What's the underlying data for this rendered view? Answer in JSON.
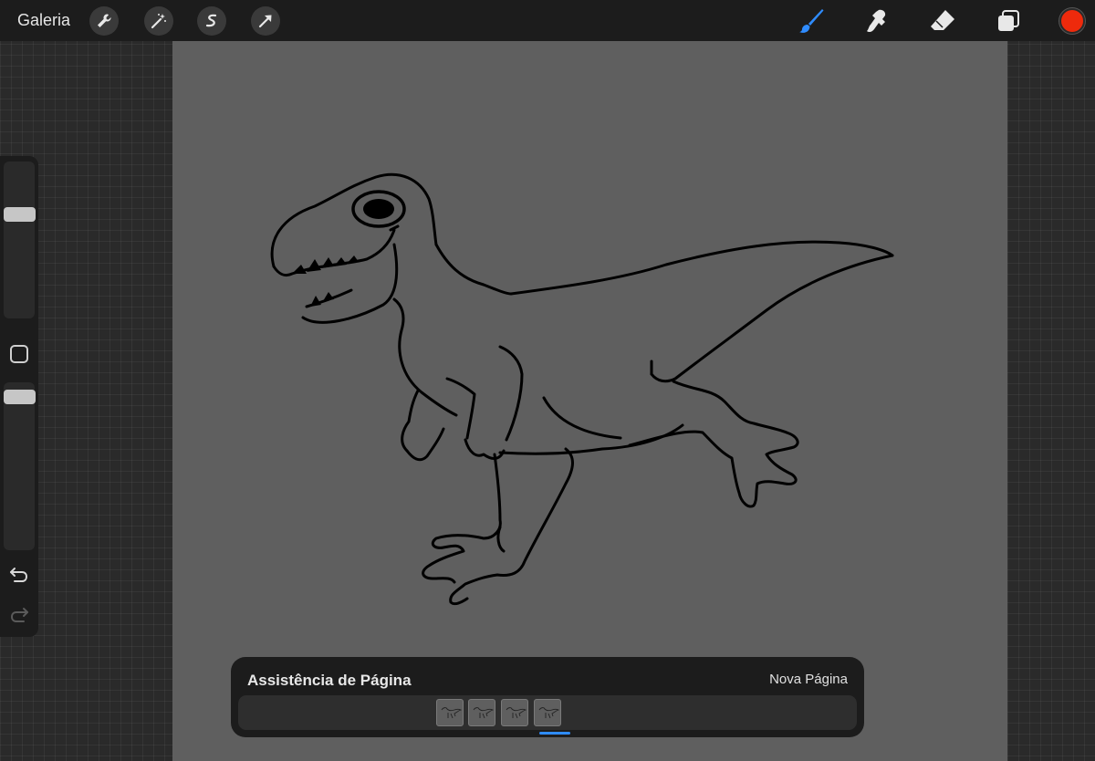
{
  "topbar": {
    "gallery_label": "Galeria",
    "left_tools": [
      {
        "name": "actions",
        "icon": "wrench-icon"
      },
      {
        "name": "adjustments",
        "icon": "magic-wand-icon"
      },
      {
        "name": "selection",
        "icon": "selection-s-icon"
      },
      {
        "name": "transform",
        "icon": "arrow-cursor-icon"
      }
    ],
    "right_tools": [
      {
        "name": "brush",
        "icon": "brush-icon",
        "active": true
      },
      {
        "name": "smudge",
        "icon": "smudge-icon"
      },
      {
        "name": "eraser",
        "icon": "eraser-icon"
      },
      {
        "name": "layers",
        "icon": "layers-icon"
      }
    ],
    "current_color": "#ee2a0c",
    "active_tool_color": "#2f8cff"
  },
  "sidebar": {
    "brush_size_level": 0.68,
    "opacity_level": 0.95,
    "undo_icon": "undo-icon",
    "redo_icon": "redo-icon"
  },
  "page_assist": {
    "title": "Assistência de Página",
    "new_page_label": "Nova Página",
    "page_count": 4,
    "selected_page": 4
  }
}
